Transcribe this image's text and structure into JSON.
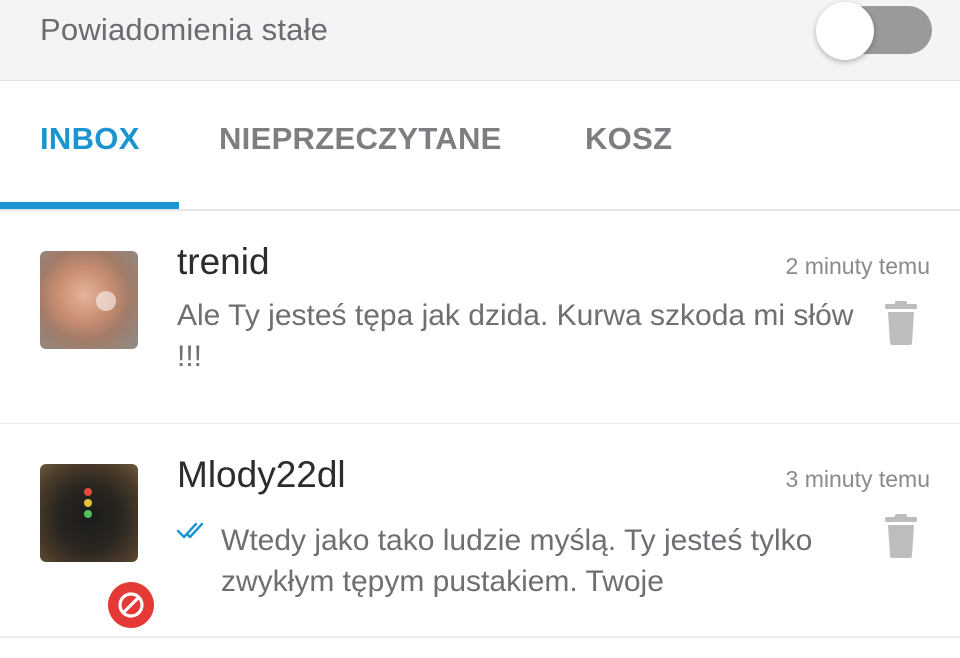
{
  "settings": {
    "persistent_notifications_label": "Powiadomienia stałe",
    "persistent_notifications_on": false
  },
  "tabs": [
    {
      "label": "INBOX",
      "active": true
    },
    {
      "label": "NIEPRZECZYTANE",
      "active": false
    },
    {
      "label": "KOSZ",
      "active": false
    }
  ],
  "messages": [
    {
      "sender": "trenid",
      "time": "2 minuty temu",
      "snippet": "Ale Ty jesteś tępa jak dzida. Kurwa szkoda mi słów !!!",
      "read_receipt": false,
      "blocked": false
    },
    {
      "sender": "Mlody22dl",
      "time": "3 minuty temu",
      "snippet": "Wtedy jako tako ludzie myślą. Ty jesteś tylko zwykłym tępym pustakiem. Twoje",
      "read_receipt": true,
      "blocked": true
    }
  ],
  "colors": {
    "accent": "#1a95d2",
    "block_badge": "#e53935"
  },
  "icons": {
    "trash": "trash-icon",
    "read_receipt": "double-check-icon",
    "blocked": "block-icon"
  }
}
